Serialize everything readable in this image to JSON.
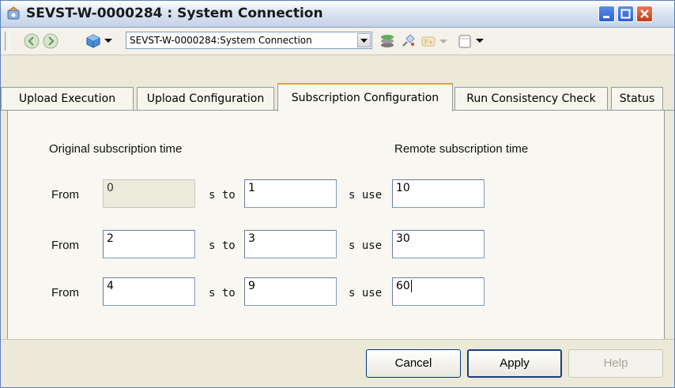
{
  "window": {
    "title": "SEVST-W-0000284 : System Connection"
  },
  "toolbar": {
    "combo_value": "SEVST-W-0000284:System Connection",
    "icons": [
      "back-icon",
      "forward-icon",
      "cube-icon",
      "dropdown-arrow-icon",
      "stack-icon",
      "pin-icon",
      "link-icon",
      "window-icon"
    ]
  },
  "tabs": [
    {
      "label": "Upload Execution",
      "active": false
    },
    {
      "label": "Upload Configuration",
      "active": false
    },
    {
      "label": "Subscription Configuration",
      "active": true
    },
    {
      "label": "Run Consistency Check",
      "active": false
    },
    {
      "label": "Status",
      "active": false
    }
  ],
  "panel": {
    "original_heading": "Original subscription time",
    "remote_heading": "Remote subscription time",
    "from_label": "From",
    "s_to_label": "s to",
    "s_use_label": "s use",
    "rows": [
      {
        "from": "0",
        "to": "1",
        "use": "10",
        "from_disabled": true
      },
      {
        "from": "2",
        "to": "3",
        "use": "30",
        "from_disabled": false
      },
      {
        "from": "4",
        "to": "9",
        "use": "60",
        "from_disabled": false
      }
    ]
  },
  "buttons": {
    "cancel": "Cancel",
    "apply": "Apply",
    "help": "Help"
  },
  "colors": {
    "tab_active_accent": "#e09e40",
    "close_button": "#c43b1a",
    "titlebar": "#dde6f2"
  }
}
